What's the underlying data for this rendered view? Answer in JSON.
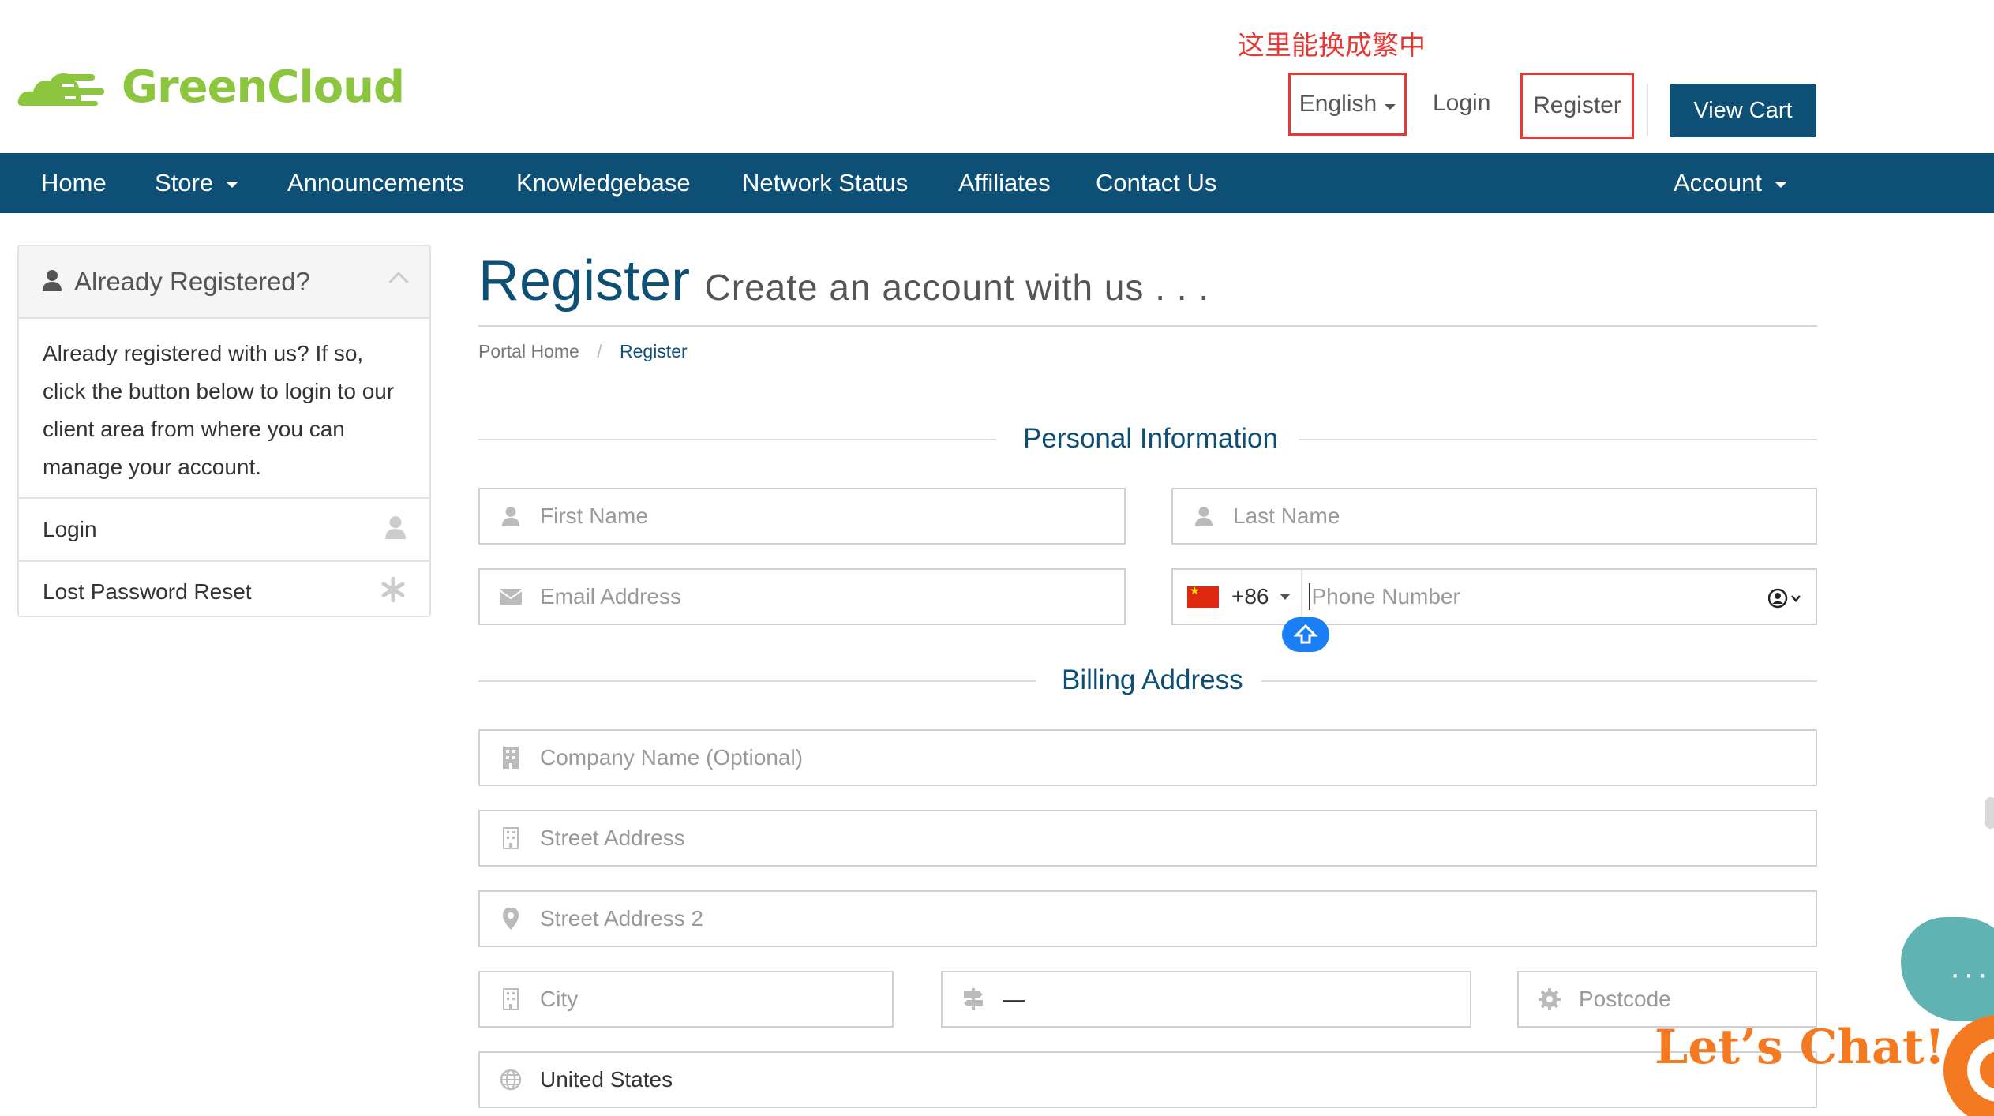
{
  "brand": {
    "name": "GreenCloud",
    "color": "#8cc63f",
    "icon": "cloud-logo-icon"
  },
  "annotation": {
    "text": "这里能换成繁中",
    "color": "#e53935"
  },
  "topnav": {
    "language": "English",
    "login": "Login",
    "register": "Register",
    "view_cart": "View Cart",
    "highlight_color": "#e53935"
  },
  "colors": {
    "primary": "#0e4f76",
    "link": "#0e4f76",
    "phone_helper": "#1a7ef5",
    "chat_bubble": "#5fb3b3",
    "chat_accent": "#f47920"
  },
  "navbar": {
    "items": [
      {
        "label": "Home"
      },
      {
        "label": "Store",
        "dropdown": true
      },
      {
        "label": "Announcements"
      },
      {
        "label": "Knowledgebase"
      },
      {
        "label": "Network Status"
      },
      {
        "label": "Affiliates"
      },
      {
        "label": "Contact Us"
      }
    ],
    "account": {
      "label": "Account",
      "dropdown": true
    }
  },
  "sidebar": {
    "title": "Already Registered?",
    "body": "Already registered with us? If so, click the button below to login to our client area from where you can manage your account.",
    "items": [
      {
        "label": "Login",
        "icon": "user-icon"
      },
      {
        "label": "Lost Password Reset",
        "icon": "asterisk-icon"
      }
    ]
  },
  "page": {
    "title": "Register",
    "subtitle": "Create an account with us . . .",
    "breadcrumb": {
      "home": "Portal Home",
      "current": "Register"
    }
  },
  "personal": {
    "heading": "Personal Information",
    "first_name_placeholder": "First Name",
    "last_name_placeholder": "Last Name",
    "email_placeholder": "Email Address",
    "phone": {
      "country_flag": "cn-flag",
      "dial_code": "+86",
      "placeholder": "Phone Number"
    }
  },
  "billing": {
    "heading": "Billing Address",
    "company_placeholder": "Company Name (Optional)",
    "street_placeholder": "Street Address",
    "street2_placeholder": "Street Address 2",
    "city_placeholder": "City",
    "state_value": "—",
    "postcode_placeholder": "Postcode",
    "country_value": "United States"
  },
  "chat": {
    "label": "Let’s Chat!",
    "dots": "···"
  }
}
